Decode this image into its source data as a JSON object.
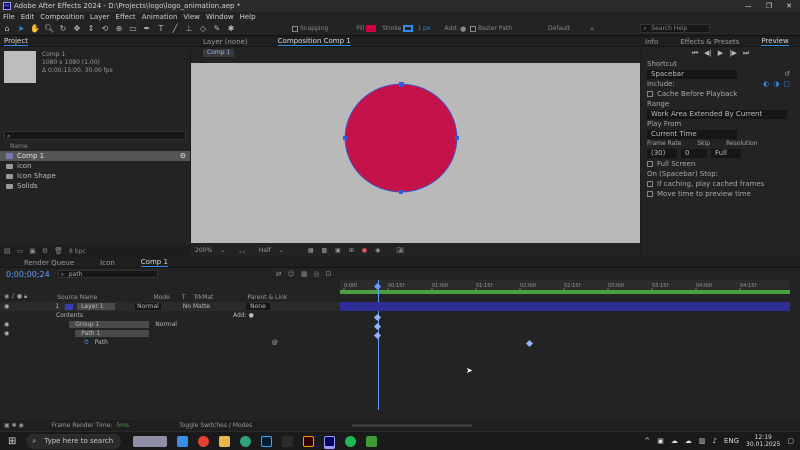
{
  "app": {
    "title": "Adobe After Effects 2024 - D:\\Projects\\logo\\logo_animation.aep *",
    "window_controls": [
      "—",
      "❐",
      "✕"
    ]
  },
  "menu": [
    "File",
    "Edit",
    "Composition",
    "Layer",
    "Effect",
    "Animation",
    "View",
    "Window",
    "Help"
  ],
  "toolbar": {
    "snapping_label": "Snapping",
    "fill_label": "Fill",
    "stroke_label": "Stroke",
    "stroke_width": "1 px",
    "add_label": "Add:",
    "bezier_label": "Bezier Path",
    "default_label": "Default",
    "search_placeholder": "Search Help",
    "fill_color": "#cc0044",
    "stroke_color": "#2d8ceb"
  },
  "project": {
    "tab": "Project",
    "comp_name": "Comp 1",
    "comp_info_1": "1080 x 1080 (1.00)",
    "comp_info_2": "Δ 0;00;15;00, 30.00 fps",
    "list_header": "Name",
    "items": [
      {
        "name": "Comp 1",
        "type": "comp"
      },
      {
        "name": "icon",
        "type": "folder"
      },
      {
        "name": "Icon Shape",
        "type": "folder"
      },
      {
        "name": "Solids",
        "type": "folder"
      }
    ],
    "bpc": "8 bpc"
  },
  "comp": {
    "tabs": [
      "Layer (none)",
      "Composition Comp 1"
    ],
    "chip": "Comp 1",
    "zoom": "200%",
    "quality": "Half",
    "circle_color": "#c4124a"
  },
  "right": {
    "tabs": [
      "Info",
      "Effects & Presets",
      "Preview"
    ],
    "shortcut_label": "Shortcut",
    "shortcut_value": "Spacebar",
    "include_label": "Include:",
    "cache_label": "Cache Before Playback",
    "range_label": "Range",
    "range_value": "Work Area Extended By Current",
    "play_from_label": "Play From",
    "play_from_value": "Current Time",
    "frame_rate_label": "Frame Rate",
    "skip_label": "Skip",
    "resolution_label": "Resolution",
    "frame_rate_value": "(30)",
    "skip_value": "0",
    "resolution_value": "Full",
    "full_screen_label": "Full Screen",
    "on_stop_label": "On (Spacebar) Stop:",
    "if_caching_label": "If caching, play cached frames",
    "move_time_label": "Move time to preview time"
  },
  "timeline": {
    "tabs": [
      "Render Queue",
      "Icon",
      "Comp 1"
    ],
    "timecode": "0;00;00;24",
    "search_value": "path",
    "columns": [
      "Source Name",
      "Mode",
      "T",
      "TrkMat",
      "Parent & Link"
    ],
    "rulers": [
      "0:00f",
      "00:15f",
      "01:00f",
      "01:15f",
      "02:00f",
      "02:15f",
      "03:00f",
      "03:15f",
      "04:00f",
      "04:15f"
    ],
    "layers": [
      {
        "num": "1",
        "name": "Layer 1",
        "mode": "Normal",
        "trkmat": "No Matte",
        "parent": "None"
      },
      {
        "num": "",
        "name": "Contents",
        "mode": "",
        "trkmat": "",
        "parent": "Add:"
      },
      {
        "num": "",
        "name": "Group 1",
        "mode": "Normal",
        "trkmat": "",
        "parent": ""
      },
      {
        "num": "",
        "name": "Path 1",
        "mode": "",
        "trkmat": "",
        "parent": ""
      },
      {
        "num": "",
        "name": "Path",
        "mode": "",
        "trkmat": "",
        "parent": ""
      }
    ]
  },
  "status": {
    "render_label": "Frame Render Time:",
    "render_value": "5ms",
    "toggle_label": "Toggle Switches / Modes"
  },
  "taskbar": {
    "search_placeholder": "Type here to search",
    "lang": "ENG",
    "time": "12:19",
    "date": "30.01.2025"
  }
}
